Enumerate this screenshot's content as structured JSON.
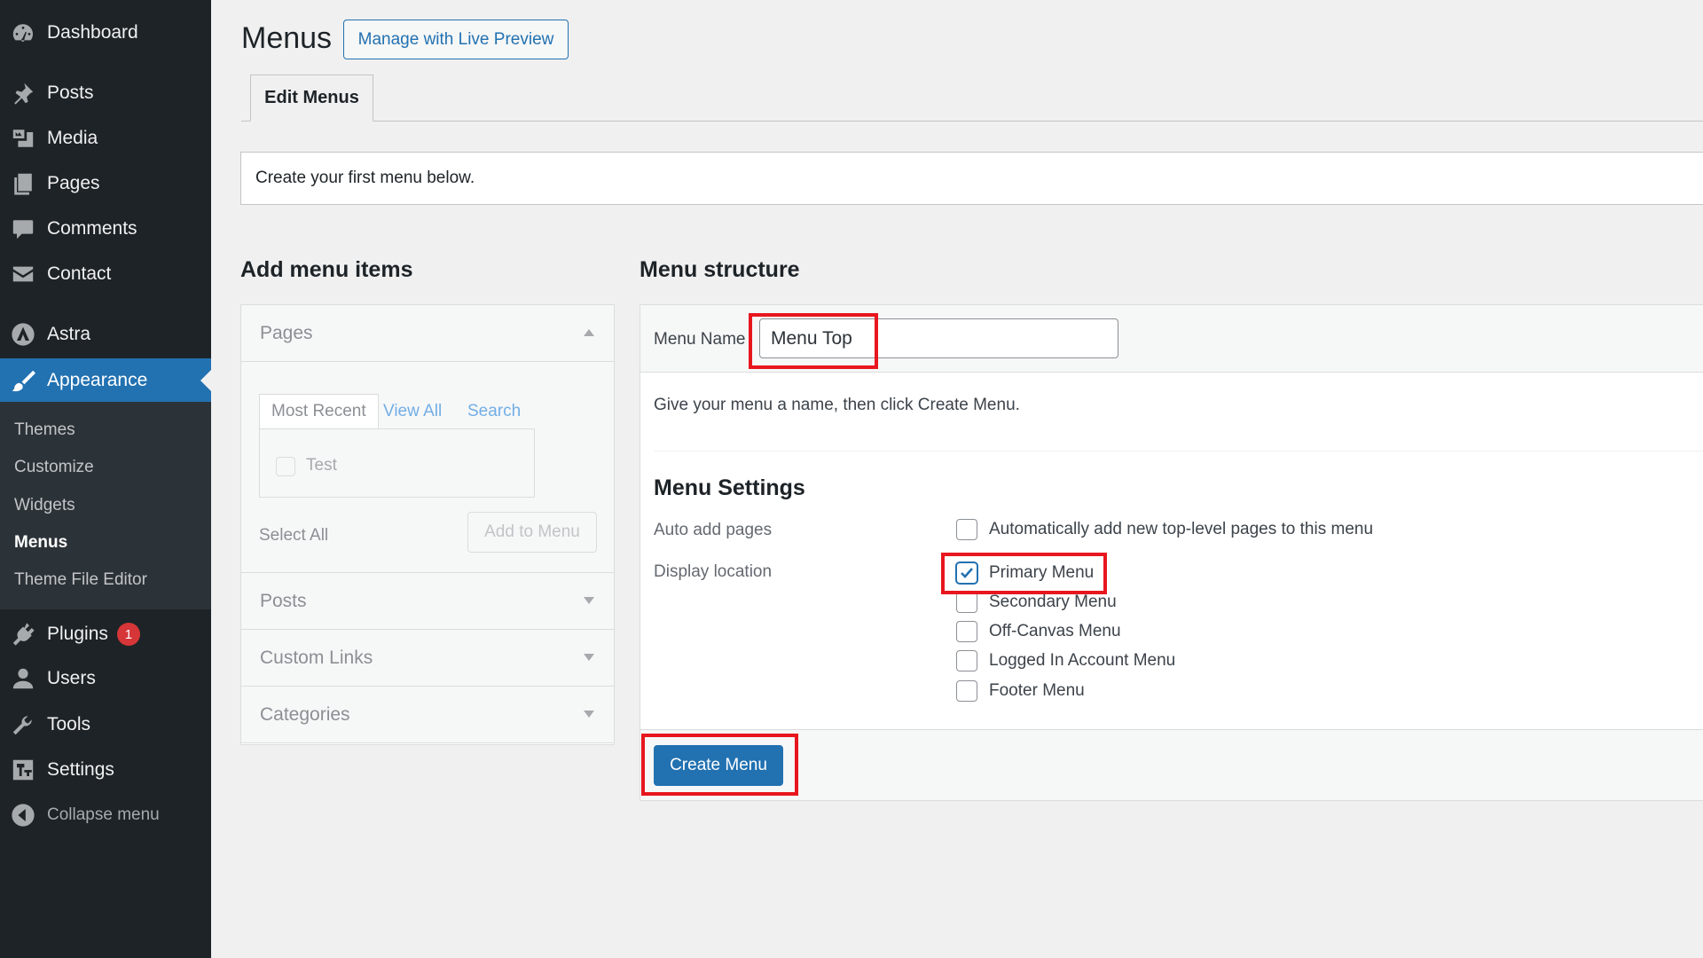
{
  "colors": {
    "sidebar_bg": "#1d2327",
    "accent": "#2271b1",
    "highlight": "#e8161e",
    "badge": "#d63638"
  },
  "sidebar": {
    "items": [
      {
        "label": "Dashboard",
        "icon": "dashboard-icon"
      },
      {
        "label": "Posts",
        "icon": "pin-icon"
      },
      {
        "label": "Media",
        "icon": "media-icon"
      },
      {
        "label": "Pages",
        "icon": "pages-icon"
      },
      {
        "label": "Comments",
        "icon": "comment-icon"
      },
      {
        "label": "Contact",
        "icon": "mail-icon"
      },
      {
        "label": "Astra",
        "icon": "astra-icon"
      },
      {
        "label": "Appearance",
        "icon": "brush-icon",
        "active": true
      },
      {
        "label": "Plugins",
        "icon": "plugin-icon",
        "badge": "1"
      },
      {
        "label": "Users",
        "icon": "user-icon"
      },
      {
        "label": "Tools",
        "icon": "wrench-icon"
      },
      {
        "label": "Settings",
        "icon": "settings-icon"
      },
      {
        "label": "Collapse menu",
        "icon": "collapse-icon"
      }
    ],
    "submenu": [
      "Themes",
      "Customize",
      "Widgets",
      "Menus",
      "Theme File Editor"
    ]
  },
  "header": {
    "title": "Menus",
    "live_preview": "Manage with Live Preview",
    "tab": "Edit Menus",
    "notice": "Create your first menu below."
  },
  "add_items": {
    "heading": "Add menu items",
    "pages": {
      "label": "Pages",
      "tabs": [
        "Most Recent",
        "View All",
        "Search"
      ],
      "items": [
        "Test"
      ],
      "select_all": "Select All",
      "add_button": "Add to Menu"
    },
    "sections": [
      "Posts",
      "Custom Links",
      "Categories"
    ]
  },
  "structure": {
    "heading": "Menu structure",
    "name_label": "Menu Name",
    "name_value": "Menu Top",
    "hint": "Give your menu a name, then click Create Menu.",
    "settings_heading": "Menu Settings",
    "auto_add_label": "Auto add pages",
    "auto_add_option": "Automatically add new top-level pages to this menu",
    "display_location_label": "Display location",
    "locations": [
      {
        "label": "Primary Menu",
        "checked": true
      },
      {
        "label": "Secondary Menu",
        "checked": false
      },
      {
        "label": "Off-Canvas Menu",
        "checked": false
      },
      {
        "label": "Logged In Account Menu",
        "checked": false
      },
      {
        "label": "Footer Menu",
        "checked": false
      }
    ],
    "create_button": "Create Menu"
  }
}
